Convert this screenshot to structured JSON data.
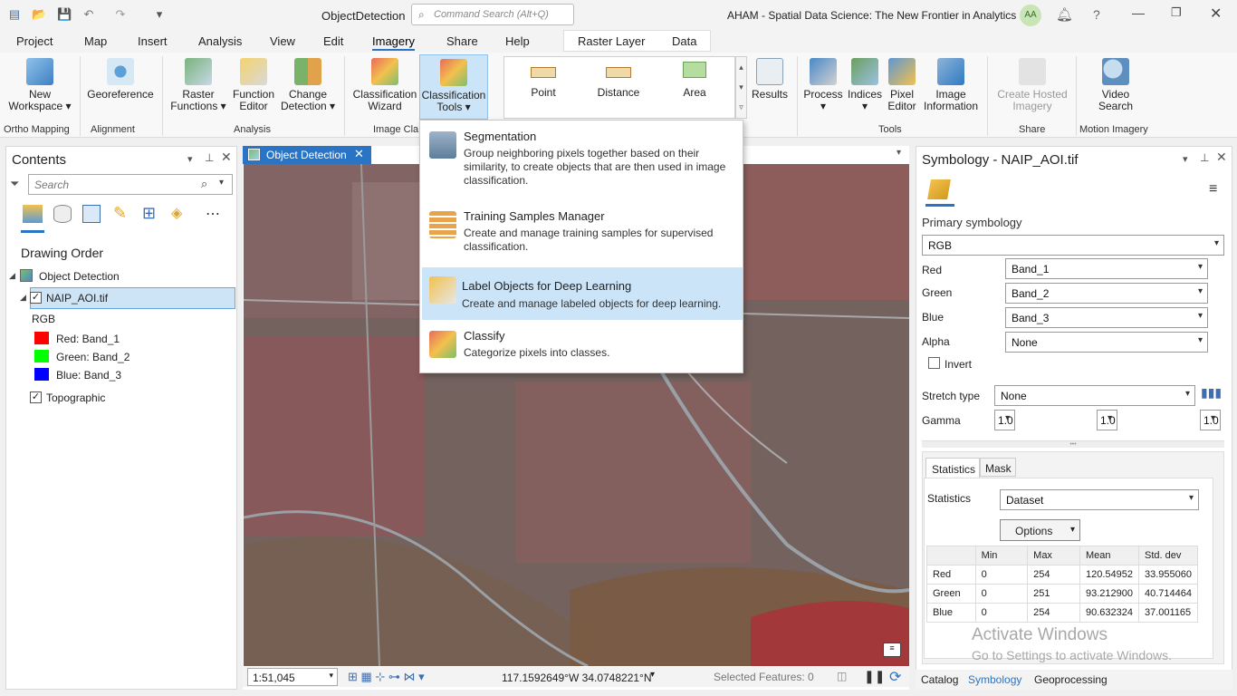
{
  "app": {
    "project_name": "ObjectDetection",
    "search_placeholder": "Command Search (Alt+Q)",
    "account": "AHAM - Spatial Data Science:  The New Frontier in Analytics",
    "user_initials": "AA"
  },
  "menu": [
    "Project",
    "Map",
    "Insert",
    "Analysis",
    "View",
    "Edit",
    "Imagery",
    "Share",
    "Help"
  ],
  "context_tabs": [
    "Raster Layer",
    "Data"
  ],
  "ribbon": {
    "new_workspace": "New Workspace",
    "georeference": "Georeference",
    "raster_functions": "Raster Functions",
    "function_editor": "Function Editor",
    "change_detection": "Change Detection",
    "classification_wizard": "Classification Wizard",
    "classification_tools": "Classification Tools",
    "point": "Point",
    "distance": "Distance",
    "area": "Area",
    "results": "Results",
    "process": "Process",
    "indices": "Indices",
    "pixel_editor": "Pixel Editor",
    "image_information": "Image Information",
    "create_hosted_imagery": "Create Hosted Imagery",
    "video_search": "Video Search",
    "groups": {
      "ortho": "Ortho Mapping",
      "alignment": "Alignment",
      "analysis": "Analysis",
      "image_cla": "Image Cla",
      "tools": "Tools",
      "share": "Share",
      "motion": "Motion Imagery"
    }
  },
  "dropdown": {
    "items": [
      {
        "title": "Segmentation",
        "desc": "Group neighboring pixels together based on their similarity, to create objects that are then used in image classification."
      },
      {
        "title": "Training Samples Manager",
        "desc": "Create and manage training samples for supervised classification."
      },
      {
        "title": "Label Objects for Deep Learning",
        "desc": "Create and manage labeled objects for deep learning."
      },
      {
        "title": "Classify",
        "desc": "Categorize pixels into classes."
      }
    ]
  },
  "contents": {
    "title": "Contents",
    "search_placeholder": "Search",
    "drawing_order": "Drawing Order",
    "map_name": "Object Detection",
    "layer_name": "NAIP_AOI.tif",
    "rgb": "RGB",
    "bands": [
      {
        "label": "Red:  Band_1",
        "color": "#ff0000"
      },
      {
        "label": "Green: Band_2",
        "color": "#00ff00"
      },
      {
        "label": "Blue:  Band_3",
        "color": "#0000ff"
      }
    ],
    "basemap": "Topographic"
  },
  "mapview": {
    "tab": "Object Detection",
    "scale": "1:51,045",
    "coords": "117.1592649°W 34.0748221°N",
    "selected_features": "Selected Features: 0"
  },
  "symbology": {
    "title": "Symbology - NAIP_AOI.tif",
    "primary": "Primary symbology",
    "renderer": "RGB",
    "red_label": "Red",
    "red_value": "Band_1",
    "green_label": "Green",
    "green_value": "Band_2",
    "blue_label": "Blue",
    "blue_value": "Band_3",
    "alpha_label": "Alpha",
    "alpha_value": "None",
    "invert": "Invert",
    "stretch_label": "Stretch type",
    "stretch_value": "None",
    "gamma_label": "Gamma",
    "gamma": [
      "1.0",
      "1.0",
      "1.0"
    ],
    "tabs": [
      "Statistics",
      "Mask"
    ],
    "statistics_label": "Statistics",
    "statistics_value": "Dataset",
    "options": "Options",
    "table_headers": [
      "",
      "Min",
      "Max",
      "Mean",
      "Std. dev"
    ],
    "rows": [
      [
        "Red",
        "0",
        "254",
        "120.54952",
        "33.955060"
      ],
      [
        "Green",
        "0",
        "251",
        "93.212900",
        "40.714464"
      ],
      [
        "Blue",
        "0",
        "254",
        "90.632324",
        "37.001165"
      ]
    ]
  },
  "watermark": {
    "line1": "Activate Windows",
    "line2": "Go to Settings to activate Windows."
  },
  "bottom_tabs": [
    "Catalog",
    "Symbology",
    "Geoprocessing"
  ]
}
